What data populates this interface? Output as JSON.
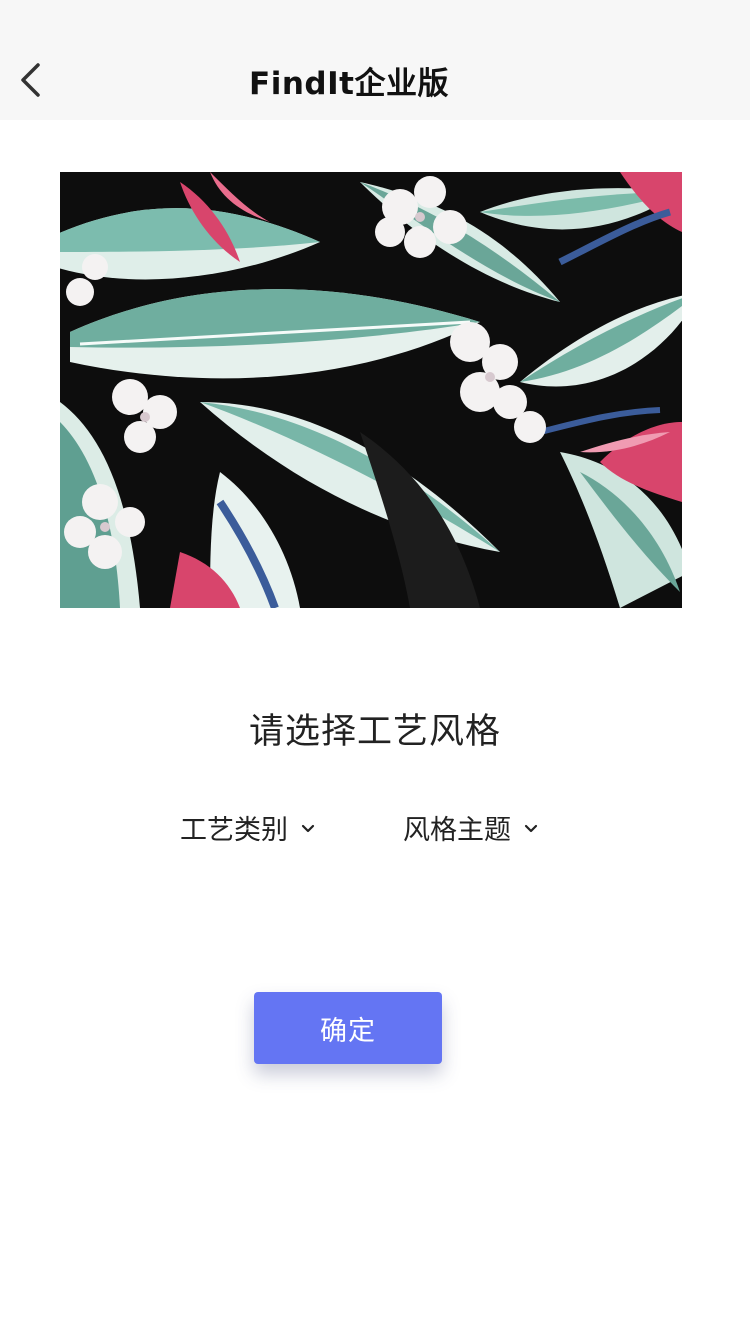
{
  "header": {
    "title": "FindIt企业版",
    "back_icon": "chevron-left-icon"
  },
  "pattern": {
    "description_icon": "floral-pattern-image",
    "colors": {
      "background": "#0d0d0d",
      "leaf_dark": "#6fae9f",
      "leaf_light": "#dfeee9",
      "flower_white": "#f4f2f2",
      "bird_pink": "#d8456c",
      "bird_blue": "#3b5c9a"
    }
  },
  "prompt": {
    "text": "请选择工艺风格"
  },
  "filters": {
    "craft_label": "工艺类别",
    "style_label": "风格主题",
    "chevron_icon": "chevron-down-icon"
  },
  "actions": {
    "confirm_label": "确定"
  },
  "theme": {
    "accent": "#6475f3",
    "header_bg": "#f7f7f7",
    "text": "#111111"
  }
}
